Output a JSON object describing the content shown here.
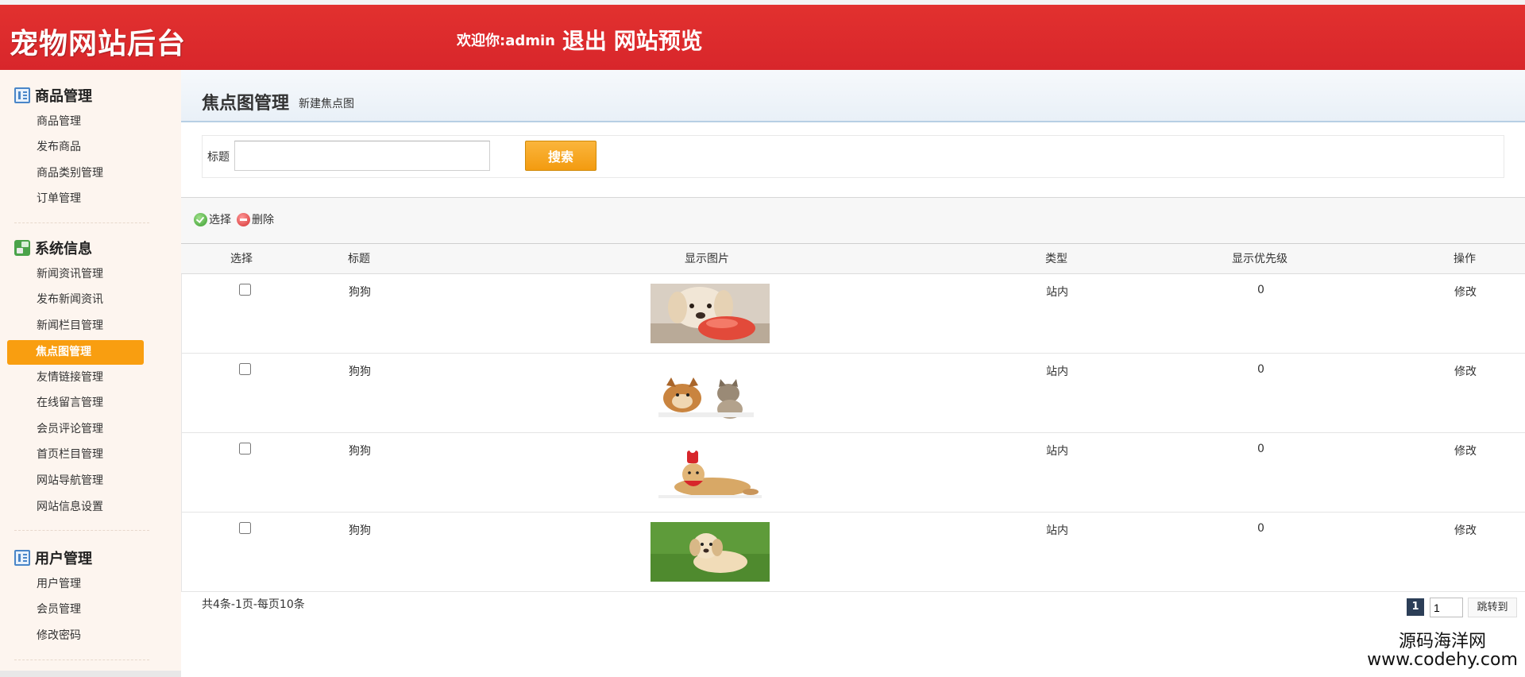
{
  "header": {
    "logo": "宠物网站后台",
    "welcome": "欢迎你:admin",
    "logout": "退出",
    "preview": "网站预览"
  },
  "sidebar": {
    "groups": [
      {
        "title": "商品管理",
        "icon": "list-icon",
        "items": [
          "商品管理",
          "发布商品",
          "商品类别管理",
          "订单管理"
        ]
      },
      {
        "title": "系统信息",
        "icon": "system-info-icon",
        "items": [
          "新闻资讯管理",
          "发布新闻资讯",
          "新闻栏目管理",
          "焦点图管理",
          "友情链接管理",
          "在线留言管理",
          "会员评论管理",
          "首页栏目管理",
          "网站导航管理",
          "网站信息设置"
        ]
      },
      {
        "title": "用户管理",
        "icon": "list-icon",
        "items": [
          "用户管理",
          "会员管理",
          "修改密码"
        ]
      }
    ],
    "active_item": "焦点图管理"
  },
  "page": {
    "title": "焦点图管理",
    "new_link": "新建焦点图"
  },
  "search": {
    "label": "标题",
    "value": "",
    "button": "搜索"
  },
  "toolbar": {
    "select": "选择",
    "delete": "删除"
  },
  "table": {
    "columns": [
      "选择",
      "标题",
      "显示图片",
      "类型",
      "显示优先级",
      "操作"
    ],
    "rows": [
      {
        "title": "狗狗",
        "image": "golden-retriever-with-toy-photo",
        "type": "站内",
        "priority": "0",
        "action": "修改"
      },
      {
        "title": "狗狗",
        "image": "dog-and-cat-photo",
        "type": "站内",
        "priority": "0",
        "action": "修改"
      },
      {
        "title": "狗狗",
        "image": "retriever-with-hat-photo",
        "type": "站内",
        "priority": "0",
        "action": "修改"
      },
      {
        "title": "狗狗",
        "image": "puppy-on-grass-photo",
        "type": "站内",
        "priority": "0",
        "action": "修改"
      }
    ]
  },
  "pagination": {
    "summary": "共4条-1页-每页10条",
    "current": "1",
    "input_value": "1",
    "jump": "跳转到"
  },
  "watermark": {
    "line1": "源码海洋网",
    "line2": "www.codehy.com"
  },
  "colors": {
    "header": "#dd2a2e",
    "active_nav": "#f99e10",
    "search_button": "#f5a623",
    "page_current": "#2c3e57",
    "sidebar_bg": "#fdf5ef"
  }
}
